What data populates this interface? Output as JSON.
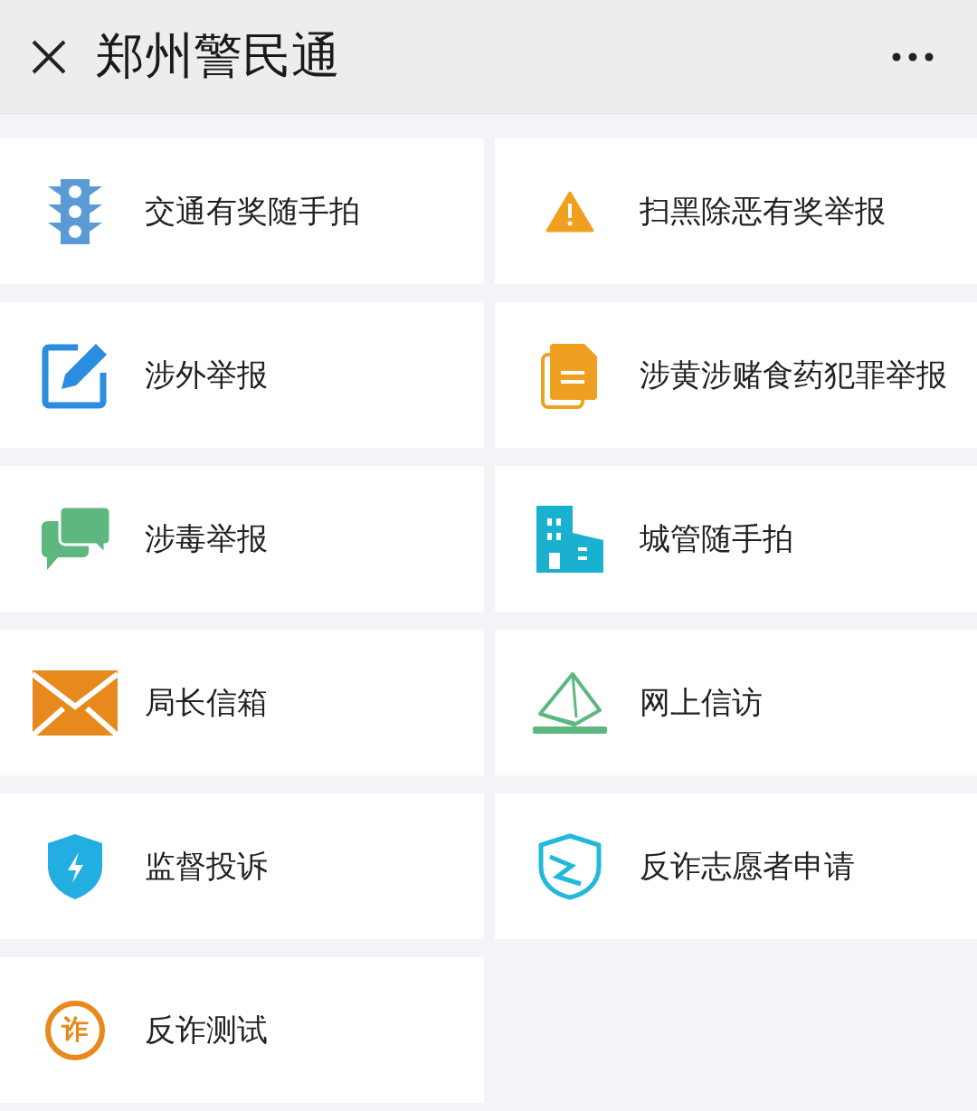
{
  "header": {
    "title": "郑州警民通"
  },
  "services": [
    {
      "label": "交通有奖随手拍"
    },
    {
      "label": "扫黑除恶有奖举报"
    },
    {
      "label": "涉外举报"
    },
    {
      "label": "涉黄涉赌食药犯罪举报"
    },
    {
      "label": "涉毒举报"
    },
    {
      "label": "城管随手拍"
    },
    {
      "label": "局长信箱"
    },
    {
      "label": "网上信访"
    },
    {
      "label": "监督投诉"
    },
    {
      "label": "反诈志愿者申请"
    },
    {
      "label": "反诈测试",
      "badge": "诈"
    }
  ]
}
